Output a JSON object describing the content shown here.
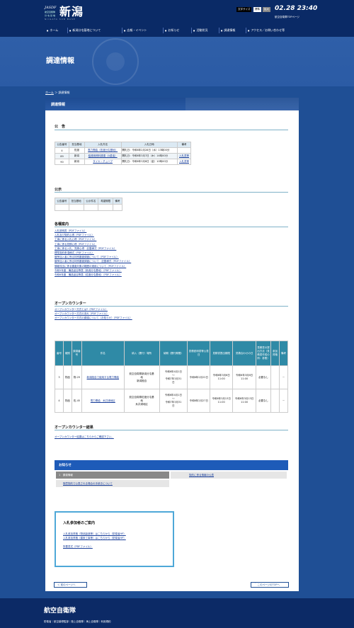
{
  "header": {
    "logo_jasdf": "JASDF",
    "logo_city": "新潟",
    "logo_sub": "航空自衛隊",
    "logo_sub2": "分屯基地",
    "logo_en": "NIIGATA SUB BASE",
    "font_size_label": "文字サイズ",
    "font_std": "標準",
    "font_large": "拡大",
    "clock": "02.28 23:40",
    "gsdf_link": "航空自衛隊TOPページ"
  },
  "nav": {
    "items": [
      {
        "label": "ホーム"
      },
      {
        "label": "新潟分屯基地について"
      },
      {
        "label": "広報・イベント"
      },
      {
        "label": "お知らせ"
      },
      {
        "label": "活動状況"
      },
      {
        "label": "調達情報"
      },
      {
        "label": "アクセス／お問い合わせ等"
      }
    ]
  },
  "hero": {
    "title": "調達情報"
  },
  "breadcrumb": {
    "home": "ホーム",
    "sep": "＞",
    "current": "調達情報"
  },
  "panel": {
    "head": "調達情報"
  },
  "kokoku": {
    "title": "公　告",
    "headers": [
      "公告番号",
      "担当基地",
      "入札件名",
      "入札日時",
      "備考"
    ],
    "rows": [
      [
        "4",
        "佐渡",
        "電力需給（佐渡分屯基地）",
        "開札日：令和6年2月28日（水）13時00分",
        ""
      ],
      [
        "89",
        "新潟",
        "給湯用燃料調達（A重油）",
        "開札日：令和6年3月7日（木）14時00分",
        "入札書等"
      ],
      [
        "90",
        "新潟",
        "タイヤ・チューブ",
        "開札日：令和6年3月8日（金）10時00分",
        "入札書等"
      ]
    ]
  },
  "koji": {
    "title": "公示",
    "headers": [
      "公告番号",
      "担当基地",
      "公示件名",
      "希望期限",
      "備考"
    ]
  },
  "info": {
    "title": "各種案内",
    "links": [
      "入札説明書（PDFファイル）",
      "入札及び契約心得（PDFファイル）",
      "工事に係る入札心得（PDFファイル）",
      "工事に係る見積心得（PDFファイル）",
      "工事に係る入札、見積心得　記載様式（PDFファイル）",
      "標準契約条項様式（PDFファイル）",
      "競争加入者に係る特別審査調査について（PDFファイル）",
      "競争加入者に係る特別審査調査について　記載様式（PDFファイル）",
      "情報流出に係る審査対象の範囲の適用について（PDFファイル）",
      "令和5年度　備品品目等表（新潟分屯基地）（PDFファイル）",
      "令和6年度　備品品目等表（佐渡分屯基地）（PDFファイル）"
    ]
  },
  "opencounter": {
    "title": "オープンカウンター",
    "links": [
      "オープンカウンター方式とは?（PDFファイル）",
      "オープンカウンター方式の流れ（PDFファイル）",
      "オープンカウンター方式の調達について（お知らせ）（PDFファイル）"
    ],
    "headers": [
      "番号",
      "種別",
      "調達番号",
      "件名",
      "納入（履行）場所",
      "納期（履行期間）",
      "見積説明書等公表日",
      "見積書提出期限",
      "見積合わせの日",
      "見積書の提出方法（見積書作成の例：参照）",
      "参加資格",
      "備考"
    ],
    "rows": [
      {
        "no": "3",
        "kind": "物品",
        "code": "物-29",
        "name": "新潟陸自で使用する電力需給",
        "place_1": "航空自衛隊新潟分屯基",
        "place_2": "地",
        "place_3": "新潟陸自",
        "period_1": "令和6年4月1日",
        "period_2": "～",
        "period_3": "令和7年3月31",
        "period_4": "日",
        "pub_date": "令和6年2月22日",
        "deadline_1": "令和6年3月6日",
        "deadline_2": "11:00",
        "match_1": "令和6年3月6日",
        "match_2": "11:00",
        "method": "必要なし",
        "qual": "",
        "note": "－"
      },
      {
        "no": "4",
        "kind": "物品",
        "code": "佐-45",
        "name": "電力需給　糸井浦地区",
        "place_1": "航空自衛隊佐渡分屯基",
        "place_2": "地",
        "place_3": "糸井浦地区",
        "period_1": "令和6年4月1日",
        "period_2": "～",
        "period_3": "令和7年3月31",
        "period_4": "日",
        "pub_date": "令和6年2月27日",
        "deadline_1": "令和6年3月13日",
        "deadline_2": "11:00",
        "match_1": "令和6年3月13日",
        "match_2": "11:00",
        "method": "必要なし",
        "qual": "",
        "note": "－"
      }
    ]
  },
  "oc_result": {
    "title": "オープンカウンター結果",
    "link": "オープンカウンター結果はこちらからご確認下さい。"
  },
  "notice": {
    "head": "お知らせ",
    "tab1": "1　調達情報",
    "tab2": "契約に係る情報の公表",
    "row": "随意契約で公表される場合の手続きについて"
  },
  "guide": {
    "title": "入札参加者のご案内",
    "links": [
      "入札参加資格（物品製造等）はこちらから（防衛省HP）",
      "入札参加資格（建設工事等）はこちらから（防衛省HP）",
      "",
      "所要書式（PDFファイル）"
    ]
  },
  "buttons": {
    "prev": "＜ 前のページへ",
    "top": "＾ このページのTOPへ"
  },
  "footer": {
    "title": "航空自衛隊",
    "links": "防衛省｜航空幕僚監部｜陸上自衛隊｜海上自衛隊｜利用規約"
  }
}
